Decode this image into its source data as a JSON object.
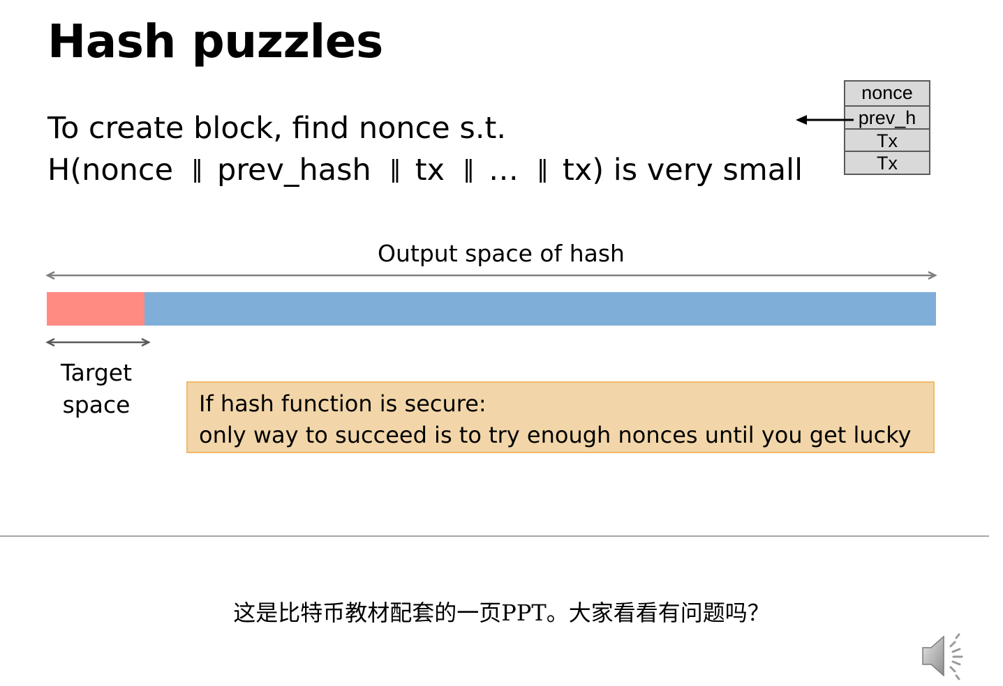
{
  "slide": {
    "title": "Hash puzzles",
    "line1": "To create block, find nonce s.t.",
    "line2": {
      "parts": [
        "H(nonce",
        "prev_hash",
        "tx",
        "…",
        "tx) is very small"
      ],
      "separator": "‖"
    },
    "block": {
      "cells": [
        "nonce",
        "prev_h",
        "Tx",
        "Tx"
      ]
    },
    "output_space_label": "Output space of hash",
    "target_label_line1": "Target",
    "target_label_line2": "space",
    "target_fraction": 0.11,
    "callout": {
      "line1": "If hash function is secure:",
      "line2": "only way to succeed is to try enough nonces until you get lucky"
    },
    "colors": {
      "target": "#ff8b82",
      "space": "#7faed9",
      "callout_fill": "#f2d6a9",
      "callout_border": "#f4b867",
      "block_fill": "#d9d9d9"
    }
  },
  "caption": "这是比特币教材配套的一页PPT。大家看看有问题吗？",
  "icons": {
    "speaker": "speaker-icon",
    "arrow": "arrow-left-icon"
  }
}
